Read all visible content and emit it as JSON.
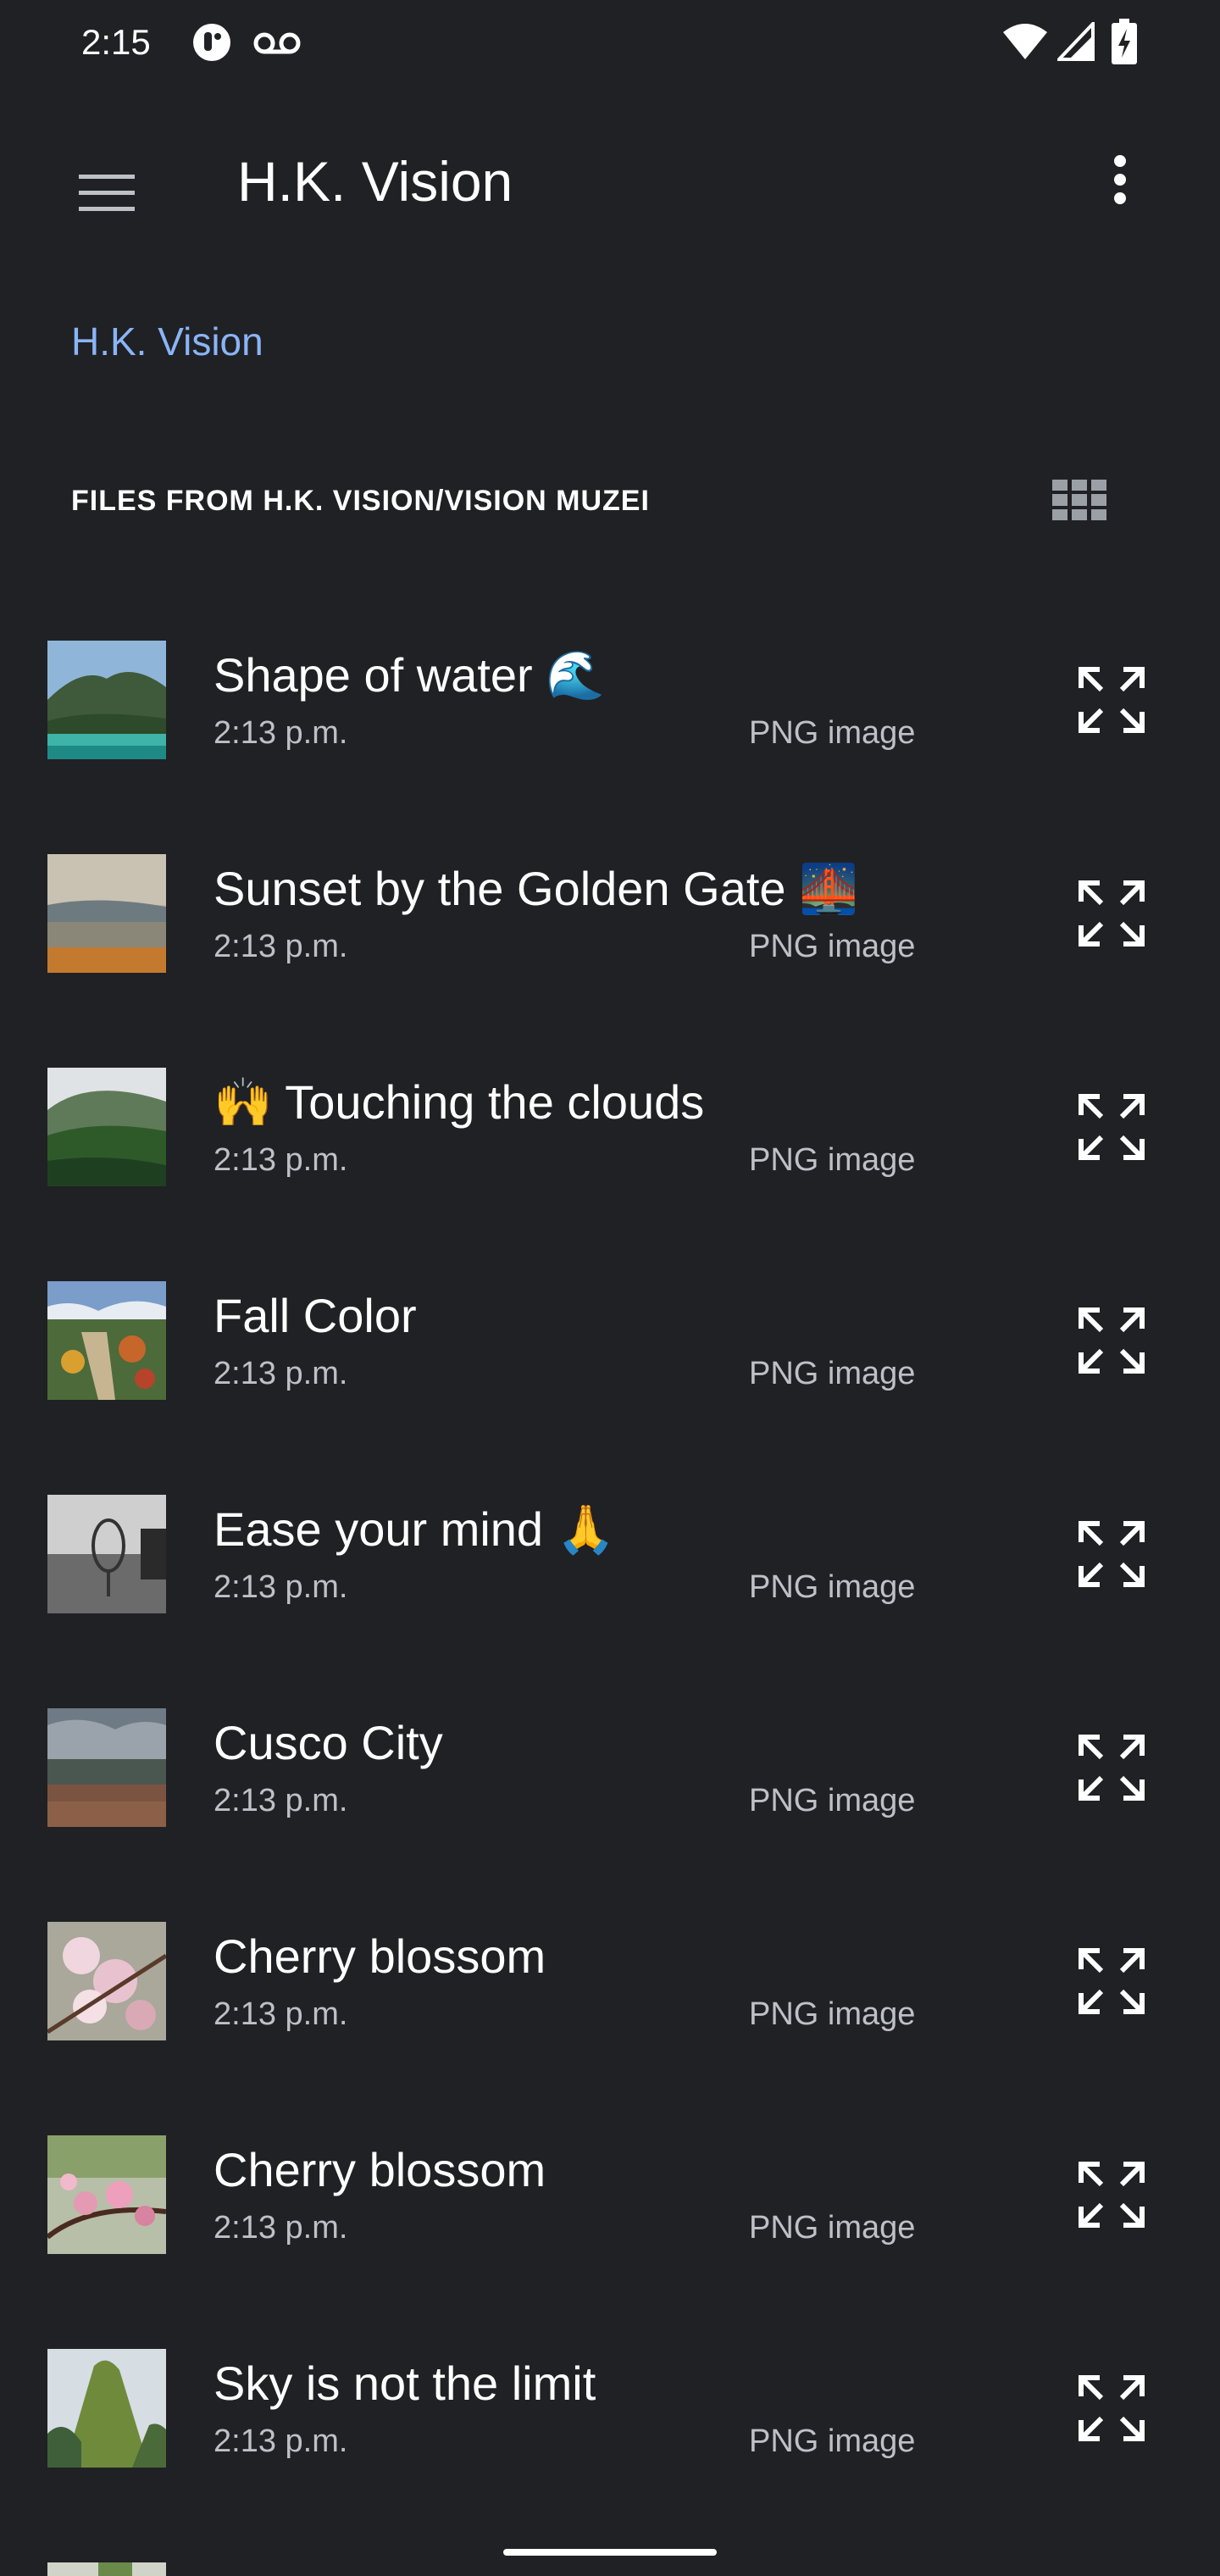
{
  "status_bar": {
    "time": "2:15",
    "icons": [
      "notification-icon",
      "voicemail-icon",
      "wifi-icon",
      "cellular-signal-icon",
      "battery-charging-icon"
    ]
  },
  "app_bar": {
    "title": "H.K. Vision",
    "menu_icon": "hamburger-menu-icon",
    "overflow_icon": "more-vert-icon"
  },
  "breadcrumb": {
    "label": "H.K. Vision"
  },
  "section": {
    "header": "FILES FROM H.K. VISION/VISION MUZEI",
    "view_toggle_icon": "grid-view-icon"
  },
  "files": [
    {
      "name": "Shape of water 🌊",
      "time": "2:13 p.m.",
      "type": "PNG image",
      "thumb": "mountain-lake-thumbnail"
    },
    {
      "name": "Sunset by the Golden Gate 🌉",
      "time": "2:13 p.m.",
      "type": "PNG image",
      "thumb": "beach-sunset-thumbnail"
    },
    {
      "name": "🙌 Touching the clouds",
      "time": "2:13 p.m.",
      "type": "PNG image",
      "thumb": "forest-clouds-thumbnail"
    },
    {
      "name": "Fall Color",
      "time": "2:13 p.m.",
      "type": "PNG image",
      "thumb": "autumn-valley-thumbnail"
    },
    {
      "name": "Ease your mind 🙏",
      "time": "2:13 p.m.",
      "type": "PNG image",
      "thumb": "black-white-glass-thumbnail"
    },
    {
      "name": "Cusco City",
      "time": "2:13 p.m.",
      "type": "PNG image",
      "thumb": "city-clouds-thumbnail"
    },
    {
      "name": "Cherry blossom",
      "time": "2:13 p.m.",
      "type": "PNG image",
      "thumb": "cherry-blossom-thumbnail"
    },
    {
      "name": "Cherry blossom",
      "time": "2:13 p.m.",
      "type": "PNG image",
      "thumb": "cherry-branch-thumbnail"
    },
    {
      "name": "Sky is not the limit",
      "time": "2:13 p.m.",
      "type": "PNG image",
      "thumb": "green-peak-thumbnail"
    }
  ],
  "colors": {
    "background": "#202124",
    "accent": "#8ab4f8",
    "primary_text": "#ffffff",
    "secondary_text": "#bdc1c6"
  }
}
